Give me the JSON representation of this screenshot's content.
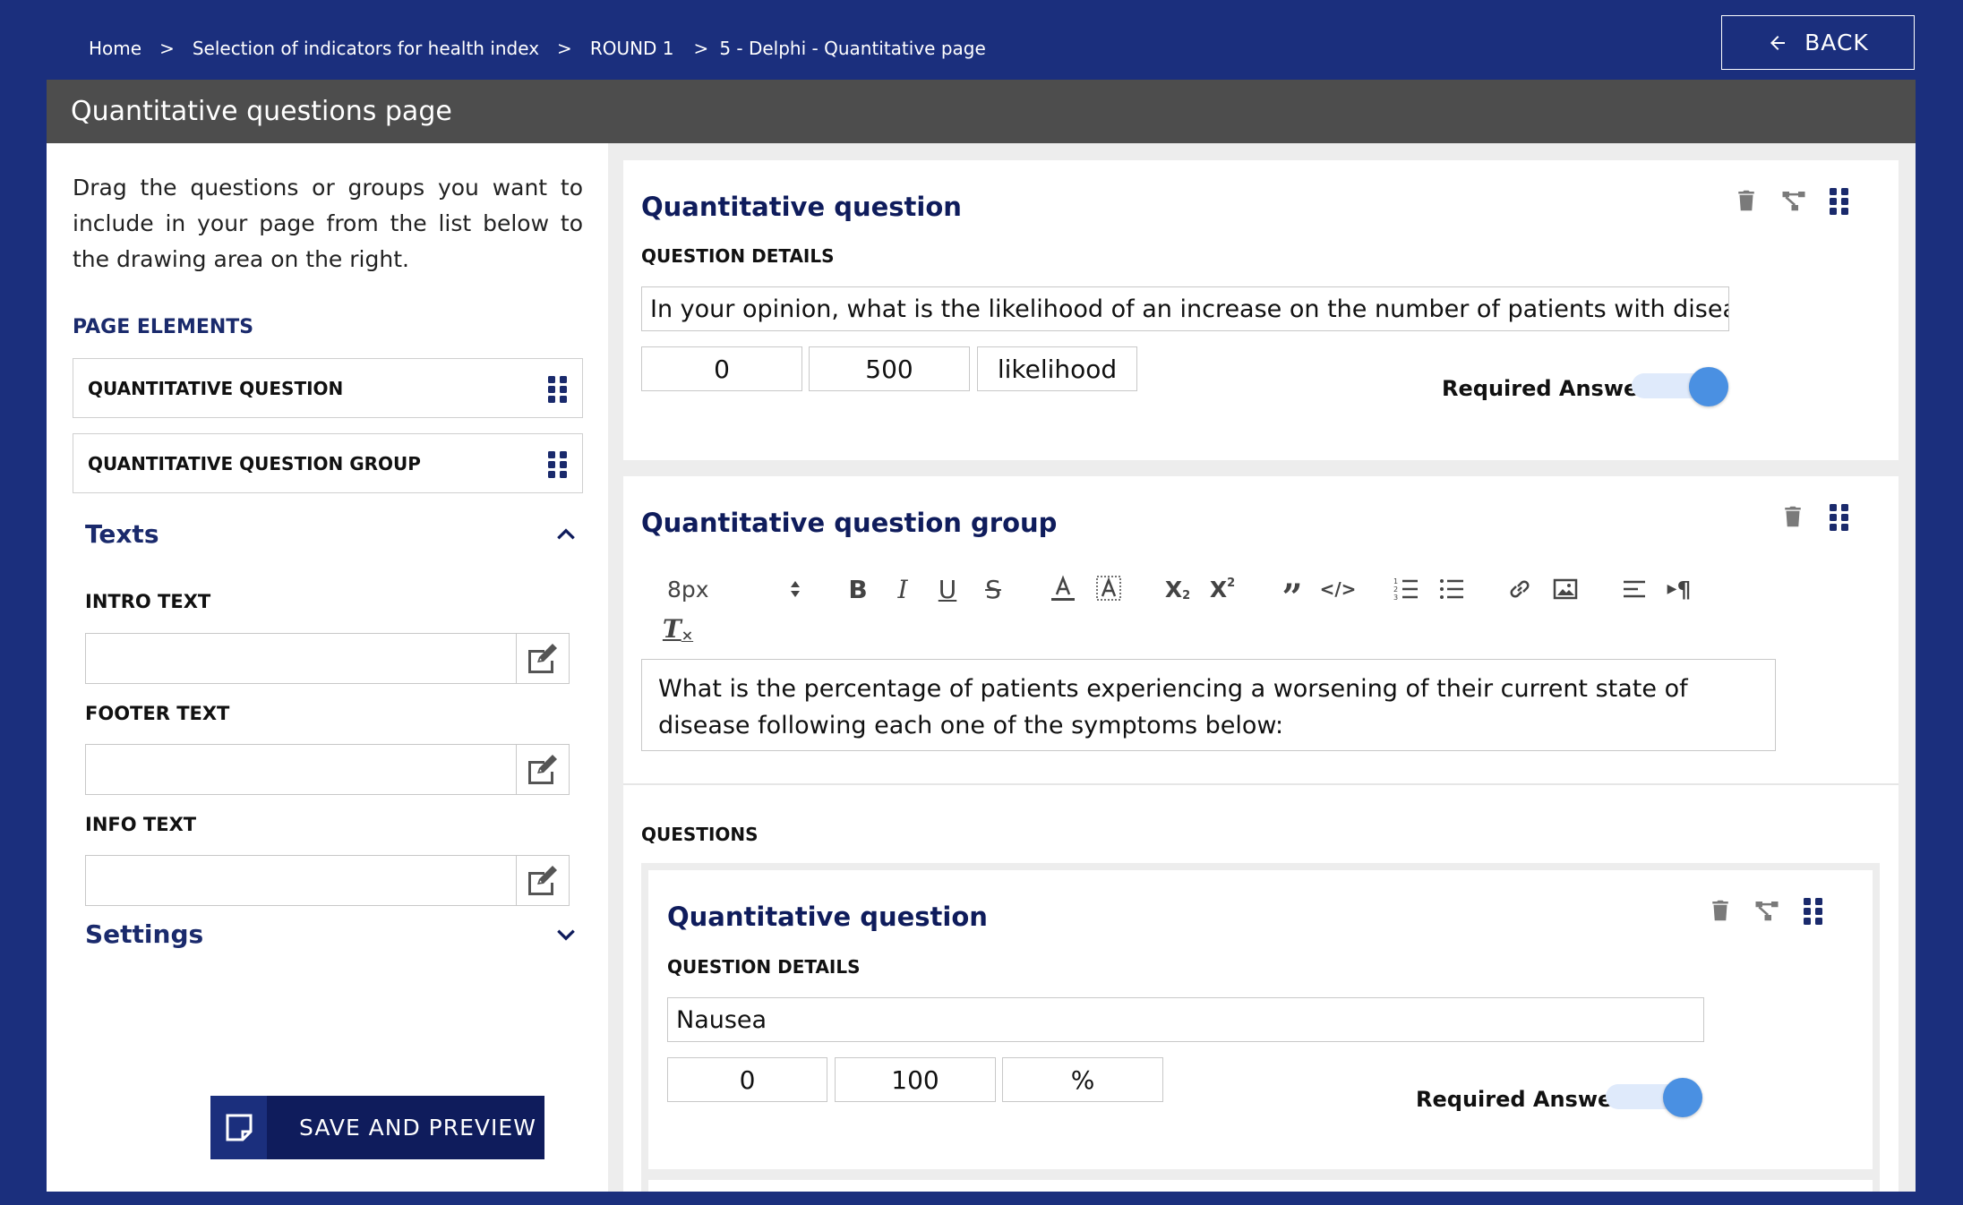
{
  "breadcrumb": [
    "Home",
    "Selection of indicators for health index",
    "ROUND 1",
    "5 - Delphi - Quantitative page"
  ],
  "back_label": "BACK",
  "page_header": "Quantitative questions page",
  "left": {
    "intro": "Drag the questions or groups you want to include in your page from the list below to the drawing area on the right.",
    "page_elements_title": "PAGE ELEMENTS",
    "elements": [
      "QUANTITATIVE QUESTION",
      "QUANTITATIVE QUESTION GROUP"
    ],
    "texts_title": "Texts",
    "intro_text_label": "INTRO TEXT",
    "footer_text_label": "FOOTER TEXT",
    "info_text_label": "INFO TEXT",
    "settings_title": "Settings",
    "save_label": "SAVE AND PREVIEW"
  },
  "question1": {
    "title": "Quantitative question",
    "details_label": "QUESTION DETAILS",
    "text": "In your opinion, what is the likelihood of an increase on the number of patients with disease X",
    "min": "0",
    "max": "500",
    "unit": "likelihood",
    "required_label": "Required Answer",
    "required": true
  },
  "group": {
    "title": "Quantitative question group",
    "font_size": "8px",
    "text": "What is the percentage of patients experiencing a worsening of their current state of disease following each one of the symptoms below:",
    "questions_label": "QUESTIONS"
  },
  "question2": {
    "title": "Quantitative question",
    "details_label": "QUESTION DETAILS",
    "text": "Nausea",
    "min": "0",
    "max": "100",
    "unit": "%",
    "required_label": "Required Answer",
    "required": true
  },
  "colors": {
    "background": "#1b2f7d",
    "header": "#4d4d4d",
    "accent": "#0f1c5c",
    "toggle": "#4a90e2"
  }
}
